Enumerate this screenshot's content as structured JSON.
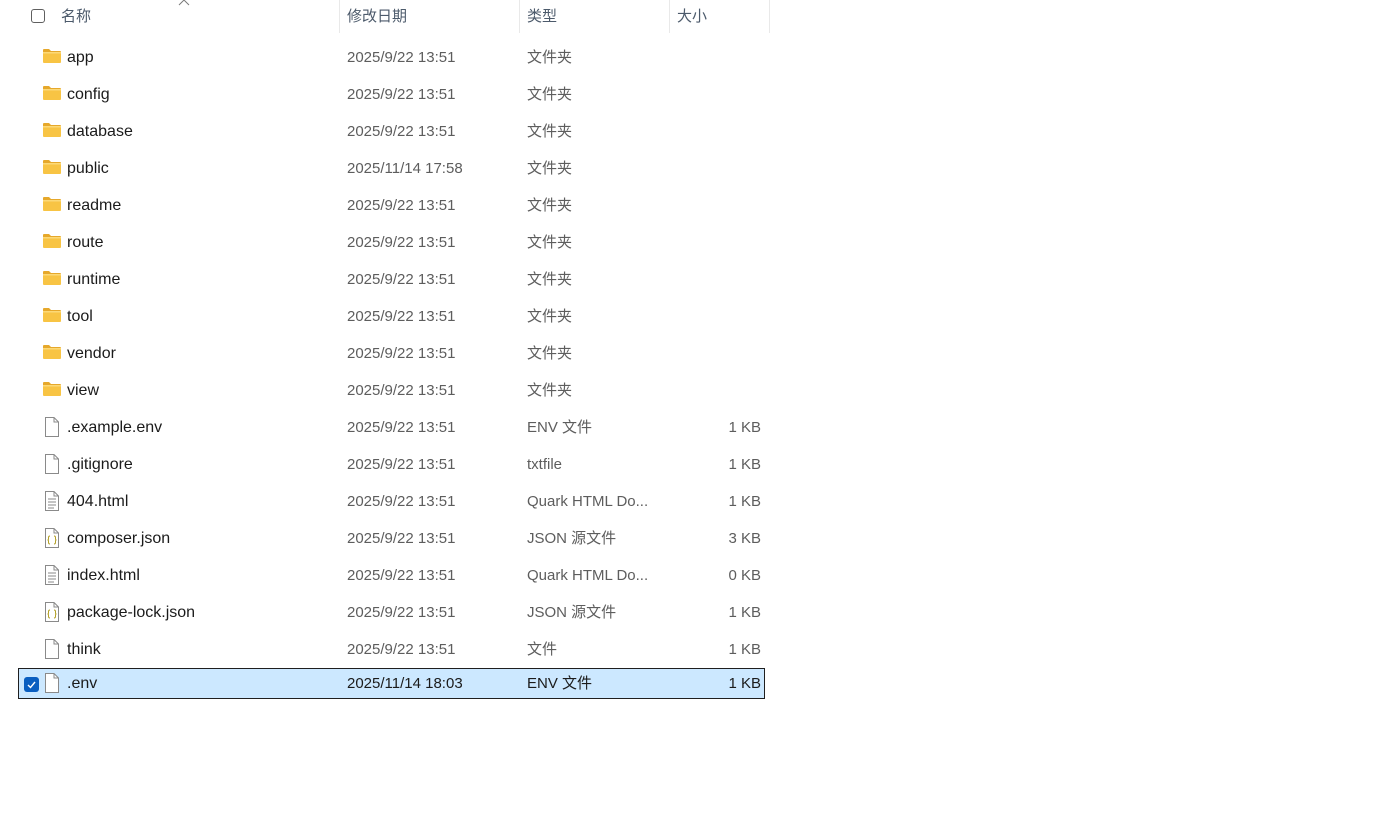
{
  "header": {
    "name": "名称",
    "date": "修改日期",
    "type": "类型",
    "size": "大小"
  },
  "files": [
    {
      "name": "app",
      "date": "2025/9/22 13:51",
      "type": "文件夹",
      "size": "",
      "icon": "folder-icon"
    },
    {
      "name": "config",
      "date": "2025/9/22 13:51",
      "type": "文件夹",
      "size": "",
      "icon": "folder-icon"
    },
    {
      "name": "database",
      "date": "2025/9/22 13:51",
      "type": "文件夹",
      "size": "",
      "icon": "folder-icon"
    },
    {
      "name": "public",
      "date": "2025/11/14 17:58",
      "type": "文件夹",
      "size": "",
      "icon": "folder-icon"
    },
    {
      "name": "readme",
      "date": "2025/9/22 13:51",
      "type": "文件夹",
      "size": "",
      "icon": "folder-icon"
    },
    {
      "name": "route",
      "date": "2025/9/22 13:51",
      "type": "文件夹",
      "size": "",
      "icon": "folder-icon"
    },
    {
      "name": "runtime",
      "date": "2025/9/22 13:51",
      "type": "文件夹",
      "size": "",
      "icon": "folder-icon"
    },
    {
      "name": "tool",
      "date": "2025/9/22 13:51",
      "type": "文件夹",
      "size": "",
      "icon": "folder-icon"
    },
    {
      "name": "vendor",
      "date": "2025/9/22 13:51",
      "type": "文件夹",
      "size": "",
      "icon": "folder-icon"
    },
    {
      "name": "view",
      "date": "2025/9/22 13:51",
      "type": "文件夹",
      "size": "",
      "icon": "folder-icon"
    },
    {
      "name": ".example.env",
      "date": "2025/9/22 13:51",
      "type": "ENV 文件",
      "size": "1 KB",
      "icon": "blank-file-icon"
    },
    {
      "name": ".gitignore",
      "date": "2025/9/22 13:51",
      "type": "txtfile",
      "size": "1 KB",
      "icon": "blank-file-icon"
    },
    {
      "name": "404.html",
      "date": "2025/9/22 13:51",
      "type": "Quark HTML Do...",
      "size": "1 KB",
      "icon": "text-file-icon"
    },
    {
      "name": "composer.json",
      "date": "2025/9/22 13:51",
      "type": "JSON 源文件",
      "size": "3 KB",
      "icon": "json-file-icon"
    },
    {
      "name": "index.html",
      "date": "2025/9/22 13:51",
      "type": "Quark HTML Do...",
      "size": "0 KB",
      "icon": "text-file-icon"
    },
    {
      "name": "package-lock.json",
      "date": "2025/9/22 13:51",
      "type": "JSON 源文件",
      "size": "1 KB",
      "icon": "json-file-icon"
    },
    {
      "name": "think",
      "date": "2025/9/22 13:51",
      "type": "文件",
      "size": "1 KB",
      "icon": "blank-file-icon"
    },
    {
      "name": ".env",
      "date": "2025/11/14 18:03",
      "type": "ENV 文件",
      "size": "1 KB",
      "icon": "blank-file-icon",
      "selected": true
    }
  ],
  "colors": {
    "selection": "#cce8ff",
    "checkbox_checked": "#0a5ec0",
    "folder": "#f8c444"
  }
}
